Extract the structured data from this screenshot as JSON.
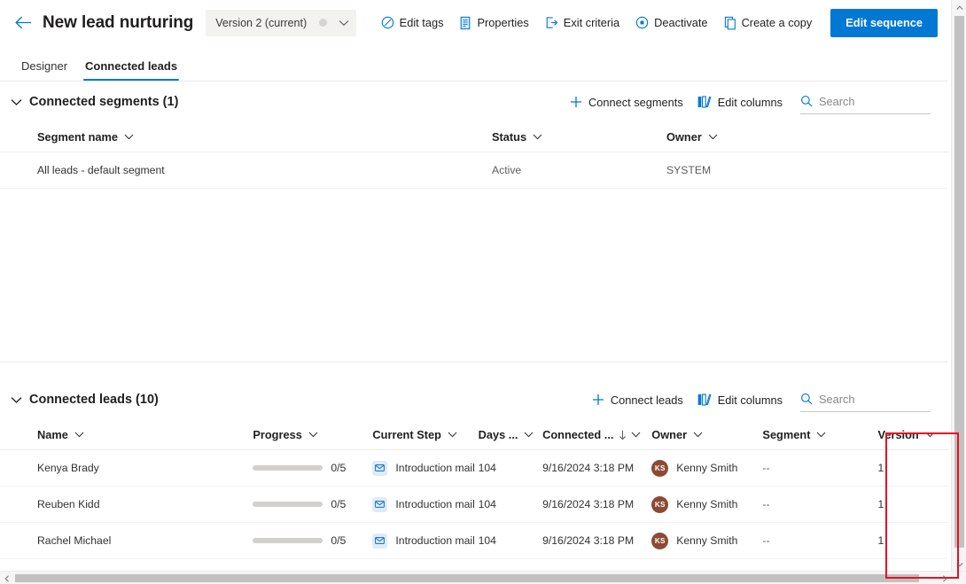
{
  "header": {
    "back_icon": "back-arrow-icon",
    "title": "New lead nurturing",
    "version_selector": {
      "label": "Version 2 (current)",
      "chevron_icon": "chevron-down-icon",
      "status_dot": "status-dot"
    },
    "actions": [
      {
        "label": "Edit tags",
        "icon": "tag-icon"
      },
      {
        "label": "Properties",
        "icon": "document-properties-icon"
      },
      {
        "label": "Exit criteria",
        "icon": "exit-icon"
      },
      {
        "label": "Deactivate",
        "icon": "circle-stop-icon"
      },
      {
        "label": "Create a copy",
        "icon": "copy-icon"
      }
    ],
    "primary_action": {
      "label": "Edit sequence",
      "color": "#0078d4"
    }
  },
  "tabs": [
    {
      "label": "Designer",
      "active": false
    },
    {
      "label": "Connected leads",
      "active": true
    }
  ],
  "segments_panel": {
    "title": "Connected segments (1)",
    "collapse_icon": "chevron-down-icon",
    "actions": [
      {
        "label": "Connect segments",
        "icon": "plus-icon"
      },
      {
        "label": "Edit columns",
        "icon": "edit-columns-icon"
      }
    ],
    "search": {
      "placeholder": "Search",
      "value": "",
      "icon": "search-icon"
    },
    "columns": [
      {
        "label": "Segment name",
        "sortable": true
      },
      {
        "label": "Status",
        "sortable": true
      },
      {
        "label": "Owner",
        "sortable": true
      }
    ],
    "rows": [
      {
        "name": "All leads - default segment",
        "status": "Active",
        "owner": "SYSTEM"
      }
    ]
  },
  "leads_panel": {
    "title": "Connected leads (10)",
    "collapse_icon": "chevron-down-icon",
    "actions": [
      {
        "label": "Connect leads",
        "icon": "plus-icon"
      },
      {
        "label": "Edit columns",
        "icon": "edit-columns-icon"
      }
    ],
    "search": {
      "placeholder": "Search",
      "value": "",
      "icon": "search-icon"
    },
    "columns": [
      {
        "label": "Name",
        "sortable": true,
        "sorted": false
      },
      {
        "label": "Progress",
        "sortable": true,
        "sorted": false
      },
      {
        "label": "Current Step",
        "sortable": true,
        "sorted": false
      },
      {
        "label": "Days ...",
        "sortable": true,
        "sorted": false
      },
      {
        "label": "Connected ...",
        "sortable": true,
        "sorted": true,
        "sort_direction": "descending",
        "sort_icon": "arrow-down-icon"
      },
      {
        "label": "Owner",
        "sortable": true,
        "sorted": false
      },
      {
        "label": "Segment",
        "sortable": true,
        "sorted": false
      },
      {
        "label": "Version",
        "sortable": true,
        "sorted": false
      }
    ],
    "rows": [
      {
        "name": "Kenya Brady",
        "progress_text": "0/5",
        "progress_value": 0,
        "progress_max": 5,
        "current_step": "Introduction mail",
        "step_icon": "mail-icon",
        "days": "104",
        "connected": "9/16/2024 3:18 PM",
        "owner": "Kenny Smith",
        "owner_initials": "KS",
        "owner_avatar_color": "#8c4a32",
        "segment": "--",
        "version": "1"
      },
      {
        "name": "Reuben Kidd",
        "progress_text": "0/5",
        "progress_value": 0,
        "progress_max": 5,
        "current_step": "Introduction mail",
        "step_icon": "mail-icon",
        "days": "104",
        "connected": "9/16/2024 3:18 PM",
        "owner": "Kenny Smith",
        "owner_initials": "KS",
        "owner_avatar_color": "#8c4a32",
        "segment": "--",
        "version": "1"
      },
      {
        "name": "Rachel Michael",
        "progress_text": "0/5",
        "progress_value": 0,
        "progress_max": 5,
        "current_step": "Introduction mail",
        "step_icon": "mail-icon",
        "days": "104",
        "connected": "9/16/2024 3:18 PM",
        "owner": "Kenny Smith",
        "owner_initials": "KS",
        "owner_avatar_color": "#8c4a32",
        "segment": "--",
        "version": "1"
      }
    ]
  },
  "annotation": {
    "highlight_color": "#e81123",
    "target": "Version column"
  },
  "scrollbars": {
    "vertical": {
      "up_icon": "scroll-up-icon",
      "down_icon": "scroll-down-icon"
    },
    "horizontal": {
      "left_icon": "scroll-left-icon",
      "right_icon": "scroll-right-icon"
    }
  }
}
